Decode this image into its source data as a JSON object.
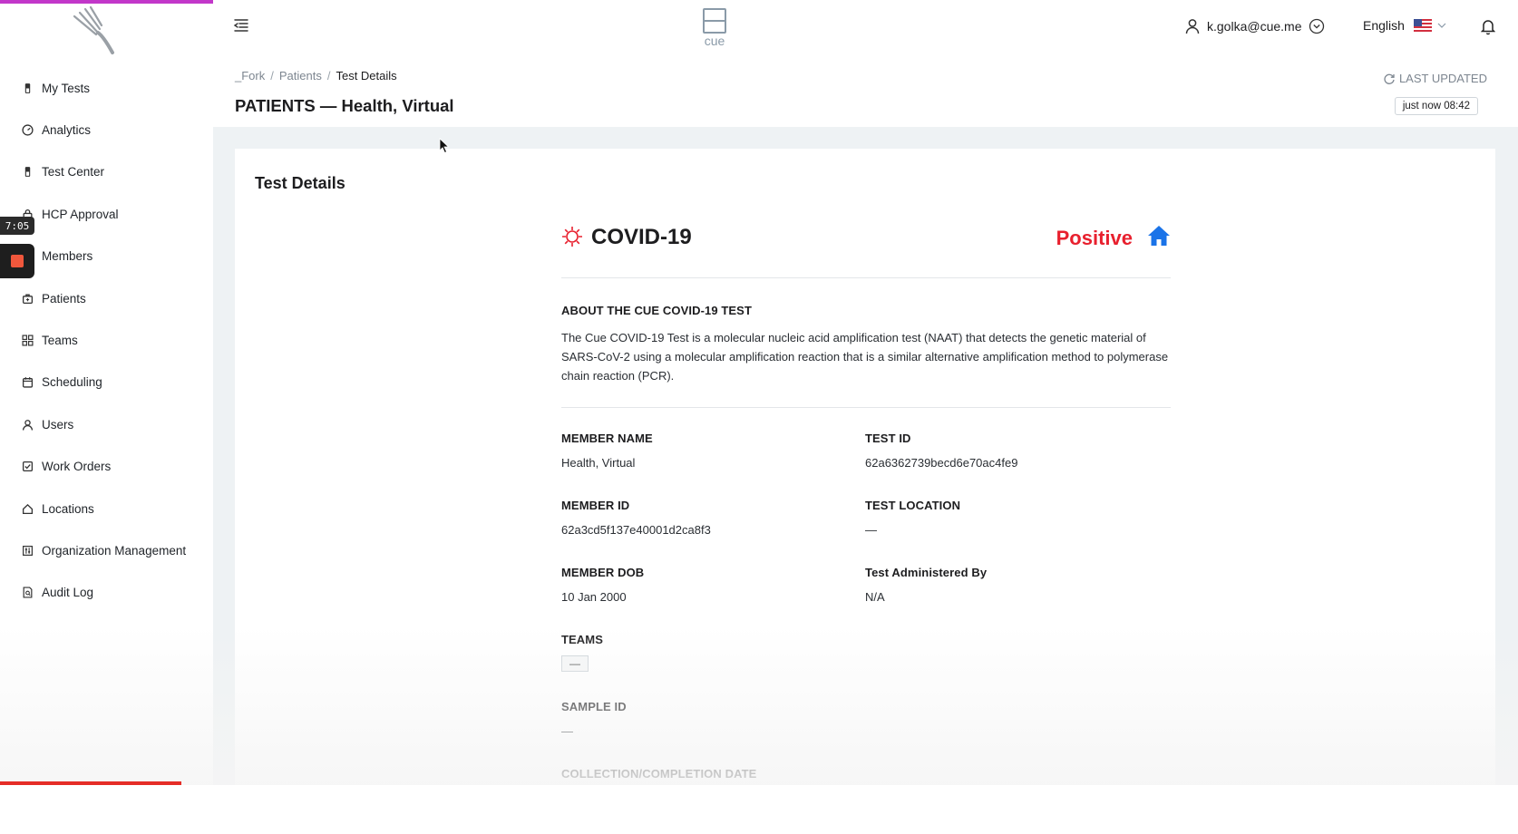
{
  "nav": [
    {
      "label": "My Tests",
      "icon": "test-tube-icon"
    },
    {
      "label": "Analytics",
      "icon": "gauge-icon"
    },
    {
      "label": "Test Center",
      "icon": "test-tube-icon"
    },
    {
      "label": "HCP Approval",
      "icon": "lock-icon"
    },
    {
      "label": "Members",
      "icon": "users-icon"
    },
    {
      "label": "Patients",
      "icon": "briefcase-icon"
    },
    {
      "label": "Teams",
      "icon": "grid-icon"
    },
    {
      "label": "Scheduling",
      "icon": "calendar-icon"
    },
    {
      "label": "Users",
      "icon": "user-icon"
    },
    {
      "label": "Work Orders",
      "icon": "checkbox-icon"
    },
    {
      "label": "Locations",
      "icon": "home-icon"
    },
    {
      "label": "Organization Management",
      "icon": "sliders-icon"
    },
    {
      "label": "Audit Log",
      "icon": "document-search-icon"
    }
  ],
  "recording": {
    "timer": "7:05"
  },
  "header": {
    "brand": "cue",
    "user_email": "k.golka@cue.me",
    "language": "English"
  },
  "breadcrumb": {
    "items": [
      "_Fork",
      "Patients",
      "Test Details"
    ]
  },
  "page_title": "PATIENTS — Health, Virtual",
  "last_updated": {
    "label": "LAST UPDATED",
    "value": "just now  08:42"
  },
  "card": {
    "title": "Test Details",
    "test_name": "COVID-19",
    "result": "Positive",
    "about_heading": "ABOUT THE CUE COVID-19 TEST",
    "about_text": "The Cue COVID-19 Test is a molecular nucleic acid amplification test (NAAT) that detects the genetic material of SARS-CoV-2 using a molecular amplification reaction that is a similar alternative amplification method to polymerase chain reaction (PCR).",
    "fields": {
      "member_name": {
        "label": "MEMBER NAME",
        "value": "Health, Virtual"
      },
      "test_id": {
        "label": "TEST ID",
        "value": "62a6362739becd6e70ac4fe9"
      },
      "member_id": {
        "label": "MEMBER ID",
        "value": "62a3cd5f137e40001d2ca8f3"
      },
      "test_location": {
        "label": "TEST LOCATION",
        "value": "—"
      },
      "member_dob": {
        "label": "MEMBER DOB",
        "value": "10 Jan 2000"
      },
      "administered_by": {
        "label": "Test Administered By",
        "value": "N/A"
      },
      "teams": {
        "label": "TEAMS",
        "value": "—"
      },
      "sample_id": {
        "label": "SAMPLE ID",
        "value": "—"
      },
      "collection_date": {
        "label": "COLLECTION/COMPLETION DATE"
      }
    }
  },
  "colors": {
    "accent": "#c237c9",
    "positive": "#e8202e",
    "home_icon": "#1a73e8",
    "canvas": "#eef2f4"
  }
}
